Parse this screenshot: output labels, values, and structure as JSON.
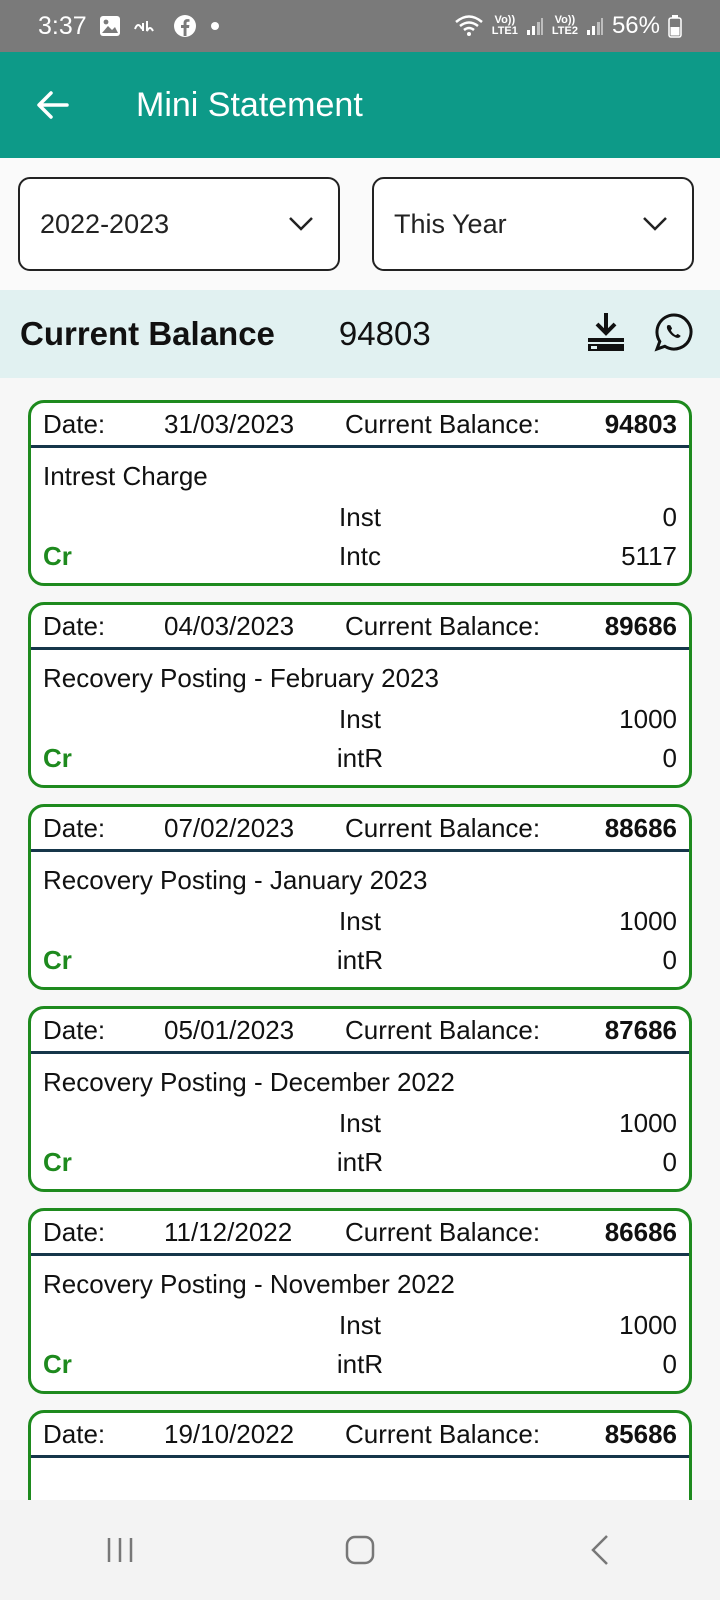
{
  "status": {
    "time": "3:37",
    "battery": "56%",
    "sim1": [
      "Vo))",
      "LTE1"
    ],
    "sim2": [
      "Vo))",
      "LTE2"
    ]
  },
  "header": {
    "title": "Mini Statement"
  },
  "filters": {
    "year": "2022-2023",
    "period": "This Year"
  },
  "balance": {
    "label": "Current Balance",
    "value": "94803"
  },
  "entries": [
    {
      "date_label": "Date:",
      "date": "31/03/2023",
      "cb_label": "Current Balance:",
      "balance": "94803",
      "description": "Intrest Charge",
      "row1_label": "Inst",
      "row1_value": "0",
      "type": "Cr",
      "row2_label": "Intc",
      "row2_value": "5117"
    },
    {
      "date_label": "Date:",
      "date": "04/03/2023",
      "cb_label": "Current Balance:",
      "balance": "89686",
      "description": "Recovery Posting - February 2023",
      "row1_label": "Inst",
      "row1_value": "1000",
      "type": "Cr",
      "row2_label": "intR",
      "row2_value": "0"
    },
    {
      "date_label": "Date:",
      "date": "07/02/2023",
      "cb_label": "Current Balance:",
      "balance": "88686",
      "description": "Recovery Posting - January 2023",
      "row1_label": "Inst",
      "row1_value": "1000",
      "type": "Cr",
      "row2_label": "intR",
      "row2_value": "0"
    },
    {
      "date_label": "Date:",
      "date": "05/01/2023",
      "cb_label": "Current Balance:",
      "balance": "87686",
      "description": "Recovery Posting - December 2022",
      "row1_label": "Inst",
      "row1_value": "1000",
      "type": "Cr",
      "row2_label": "intR",
      "row2_value": "0"
    },
    {
      "date_label": "Date:",
      "date": "11/12/2022",
      "cb_label": "Current Balance:",
      "balance": "86686",
      "description": "Recovery Posting - November 2022",
      "row1_label": "Inst",
      "row1_value": "1000",
      "type": "Cr",
      "row2_label": "intR",
      "row2_value": "0"
    },
    {
      "date_label": "Date:",
      "date": "19/10/2022",
      "cb_label": "Current Balance:",
      "balance": "85686"
    }
  ],
  "colors": {
    "app_bar": "#0d9a88",
    "card_border": "#1e8a1e",
    "balance_bg": "#e1f1f1",
    "credit": "#1e8a1e"
  }
}
